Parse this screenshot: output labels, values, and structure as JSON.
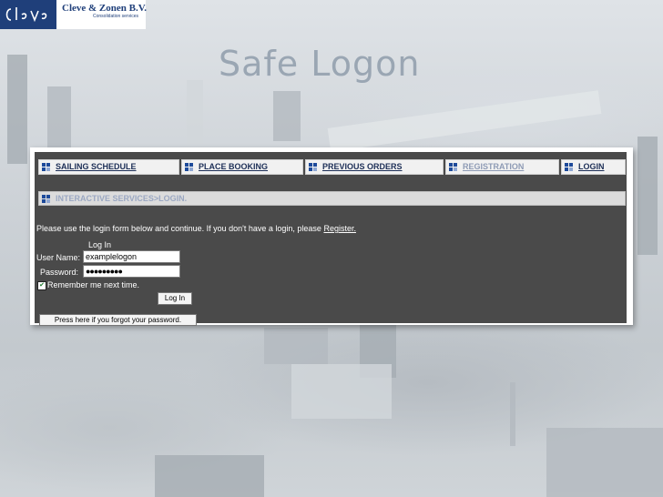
{
  "logo": {
    "mark_text": "Cleve",
    "company_name": "Cleve & Zonen B.V.",
    "tagline": "Consolidation services"
  },
  "slide": {
    "title": "Safe Logon"
  },
  "nav": {
    "items": [
      {
        "label": "SAILING SCHEDULE",
        "icon": "grid-icon"
      },
      {
        "label": "PLACE BOOKING",
        "icon": "grid-icon"
      },
      {
        "label": "PREVIOUS ORDERS",
        "icon": "grid-icon"
      },
      {
        "label": "REGISTRATION",
        "icon": "grid-icon"
      },
      {
        "label": "LOGIN",
        "icon": "grid-icon"
      }
    ]
  },
  "breadcrumb": {
    "label": "INTERACTIVE SERVICES>LOGIN."
  },
  "intro": {
    "text": "Please use the login form below and continue. If you don't have a login, please",
    "link": "Register."
  },
  "form": {
    "title": "Log In",
    "username_label": "User Name:",
    "username_value": "examplelogon",
    "password_label": "Password:",
    "password_value": "●●●●●●●●●",
    "remember_label": "Remember me next time.",
    "remember_checked": true,
    "login_button": "Log In",
    "forgot_button": "Press here if you forgot your password."
  },
  "colors": {
    "brand_blue": "#1f3f7a",
    "panel_bg": "#4a4a4a",
    "title_gray": "#9aa6b3"
  }
}
